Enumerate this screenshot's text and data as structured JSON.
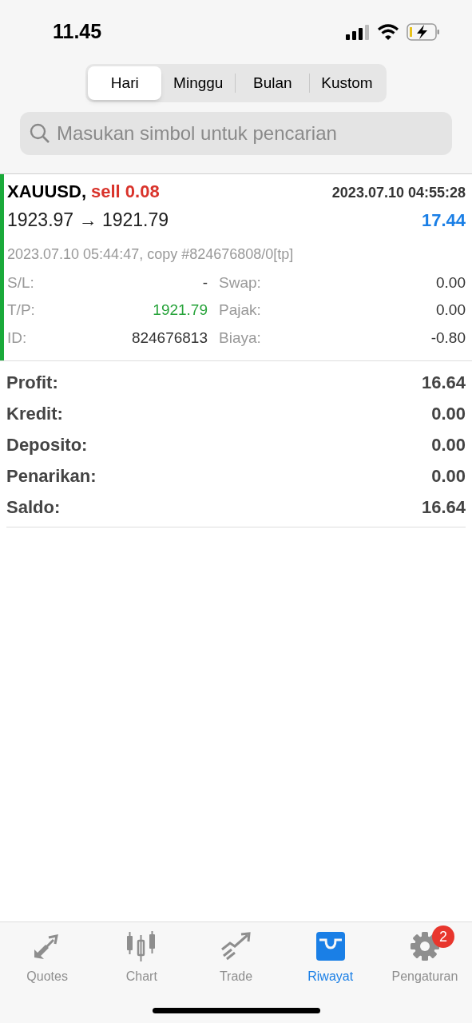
{
  "status_bar": {
    "time": "11.45"
  },
  "periods": [
    {
      "label": "Hari",
      "selected": true
    },
    {
      "label": "Minggu",
      "selected": false
    },
    {
      "label": "Bulan",
      "selected": false
    },
    {
      "label": "Kustom",
      "selected": false
    }
  ],
  "search": {
    "placeholder": "Masukan simbol untuk pencarian"
  },
  "deals": [
    {
      "symbol": "XAUUSD,",
      "kind": "sell",
      "action": "sell 0.08",
      "open_time": "2023.07.10 04:55:28",
      "prices": "1923.97 → 1921.79",
      "profit": "17.44",
      "comment": "2023.07.10 05:44:47, copy #824676808/0[tp]",
      "details_left": [
        {
          "label": "S/L:",
          "value": "-",
          "kind": "plain"
        },
        {
          "label": "T/P:",
          "value": "1921.79",
          "kind": "tp"
        },
        {
          "label": "ID:",
          "value": "824676813",
          "kind": "plain"
        }
      ],
      "details_right": [
        {
          "label": "Swap:",
          "value": "0.00"
        },
        {
          "label": "Pajak:",
          "value": "0.00"
        },
        {
          "label": "Biaya:",
          "value": "-0.80"
        }
      ]
    }
  ],
  "summary": [
    {
      "label": "Profit:",
      "value": "16.64"
    },
    {
      "label": "Kredit:",
      "value": "0.00"
    },
    {
      "label": "Deposito:",
      "value": "0.00"
    },
    {
      "label": "Penarikan:",
      "value": "0.00"
    },
    {
      "label": "Saldo:",
      "value": "16.64"
    }
  ],
  "tab_bar": [
    {
      "label": "Quotes",
      "kind": "quotes",
      "selected": false
    },
    {
      "label": "Chart",
      "kind": "chart",
      "selected": false
    },
    {
      "label": "Trade",
      "kind": "trade",
      "selected": false
    },
    {
      "label": "Riwayat",
      "kind": "history",
      "selected": true
    },
    {
      "label": "Pengaturan",
      "kind": "settings",
      "selected": false,
      "badge": "2"
    }
  ]
}
